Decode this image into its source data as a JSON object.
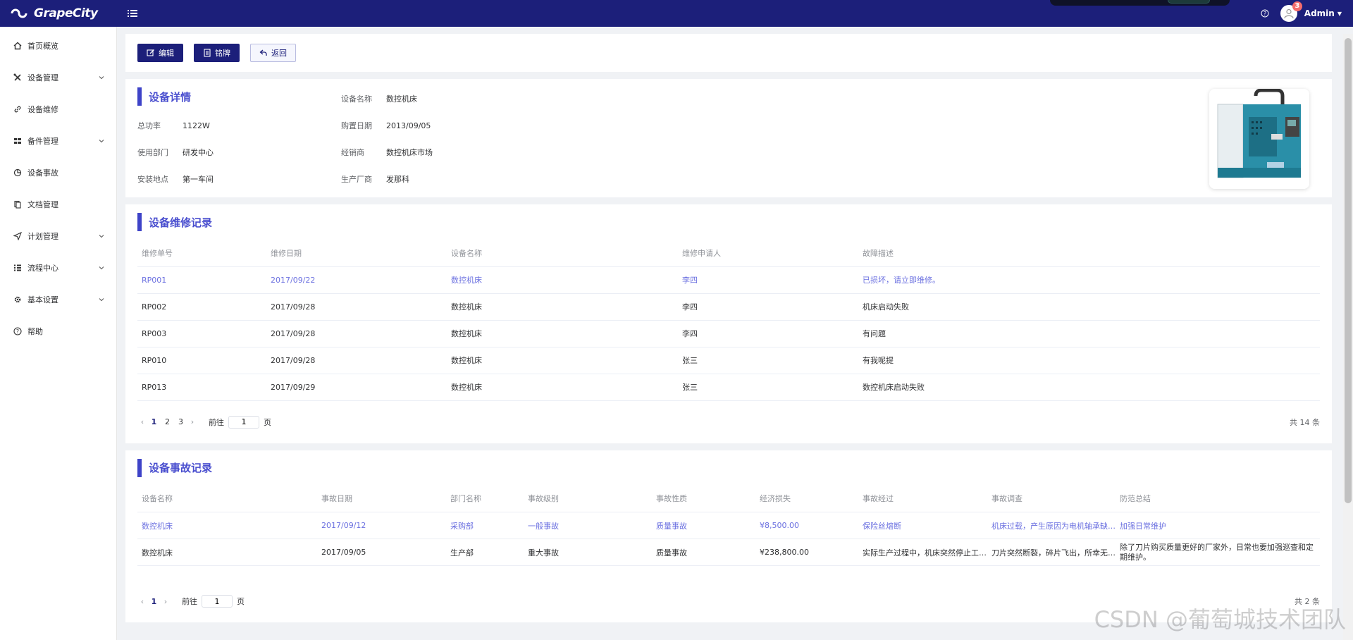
{
  "header": {
    "brand": "GrapeCity",
    "badge_count": "3",
    "user_name": "Admin"
  },
  "sidebar": {
    "items": [
      {
        "label": "首页概览",
        "icon": "home-icon",
        "expandable": false
      },
      {
        "label": "设备管理",
        "icon": "tools-icon",
        "expandable": true
      },
      {
        "label": "设备维修",
        "icon": "link-icon",
        "expandable": false
      },
      {
        "label": "备件管理",
        "icon": "grid-icon",
        "expandable": true
      },
      {
        "label": "设备事故",
        "icon": "pie-chart-icon",
        "expandable": false
      },
      {
        "label": "文档管理",
        "icon": "document-icon",
        "expandable": false
      },
      {
        "label": "计划管理",
        "icon": "send-icon",
        "expandable": true
      },
      {
        "label": "流程中心",
        "icon": "flow-icon",
        "expandable": true
      },
      {
        "label": "基本设置",
        "icon": "gear-icon",
        "expandable": true
      },
      {
        "label": "帮助",
        "icon": "help-circle-icon",
        "expandable": false
      }
    ]
  },
  "toolbar": {
    "edit_label": "编辑",
    "nameplate_label": "铭牌",
    "back_label": "返回"
  },
  "detail": {
    "title": "设备详情",
    "fields": {
      "power_label": "总功率",
      "power_value": "1122W",
      "dept_label": "使用部门",
      "dept_value": "研发中心",
      "location_label": "安装地点",
      "location_value": "第一车间",
      "name_label": "设备名称",
      "name_value": "数控机床",
      "date_label": "购置日期",
      "date_value": "2013/09/05",
      "dealer_label": "经销商",
      "dealer_value": "数控机床市场",
      "maker_label": "生产厂商",
      "maker_value": "发那科"
    }
  },
  "repair": {
    "title": "设备维修记录",
    "columns": [
      "维修单号",
      "维修日期",
      "设备名称",
      "维修申请人",
      "故障描述"
    ],
    "rows": [
      [
        "RP001",
        "2017/09/22",
        "数控机床",
        "李四",
        "已损坏，请立即维修。"
      ],
      [
        "RP002",
        "2017/09/28",
        "数控机床",
        "李四",
        "机床启动失败"
      ],
      [
        "RP003",
        "2017/09/28",
        "数控机床",
        "李四",
        "有问题"
      ],
      [
        "RP010",
        "2017/09/28",
        "数控机床",
        "张三",
        "有我呢提"
      ],
      [
        "RP013",
        "2017/09/29",
        "数控机床",
        "张三",
        "数控机床启动失败"
      ]
    ],
    "pager": {
      "pages": [
        "1",
        "2",
        "3"
      ],
      "goto_label": "前往",
      "goto_value": "1",
      "page_suffix": "页",
      "total": "共 14 条"
    }
  },
  "accident": {
    "title": "设备事故记录",
    "columns": [
      "设备名称",
      "事故日期",
      "部门名称",
      "事故级别",
      "事故性质",
      "经济损失",
      "事故经过",
      "事故调查",
      "防范总结"
    ],
    "rows": [
      [
        "数控机床",
        "2017/09/12",
        "采购部",
        "一般事故",
        "质量事故",
        "¥8,500.00",
        "保险丝熔断",
        "机床过载，产生原因为电机轴承缺…",
        "加强日常维护"
      ],
      [
        "数控机床",
        "2017/09/05",
        "生产部",
        "重大事故",
        "质量事故",
        "¥238,800.00",
        "实际生产过程中，机床突然停止工…",
        "刀片突然断裂，碎片飞出，所幸无…",
        "除了刀片购买质量更好的厂家外，日常也要加强巡查和定期维护。"
      ]
    ],
    "pager": {
      "pages": [
        "1"
      ],
      "goto_label": "前往",
      "goto_value": "1",
      "page_suffix": "页",
      "total": "共 2 条"
    }
  },
  "watermark": "CSDN @葡萄城技术团队",
  "colors": {
    "primary": "#1c1f7a",
    "accent": "#3e43c8",
    "link": "#6b70e0"
  }
}
